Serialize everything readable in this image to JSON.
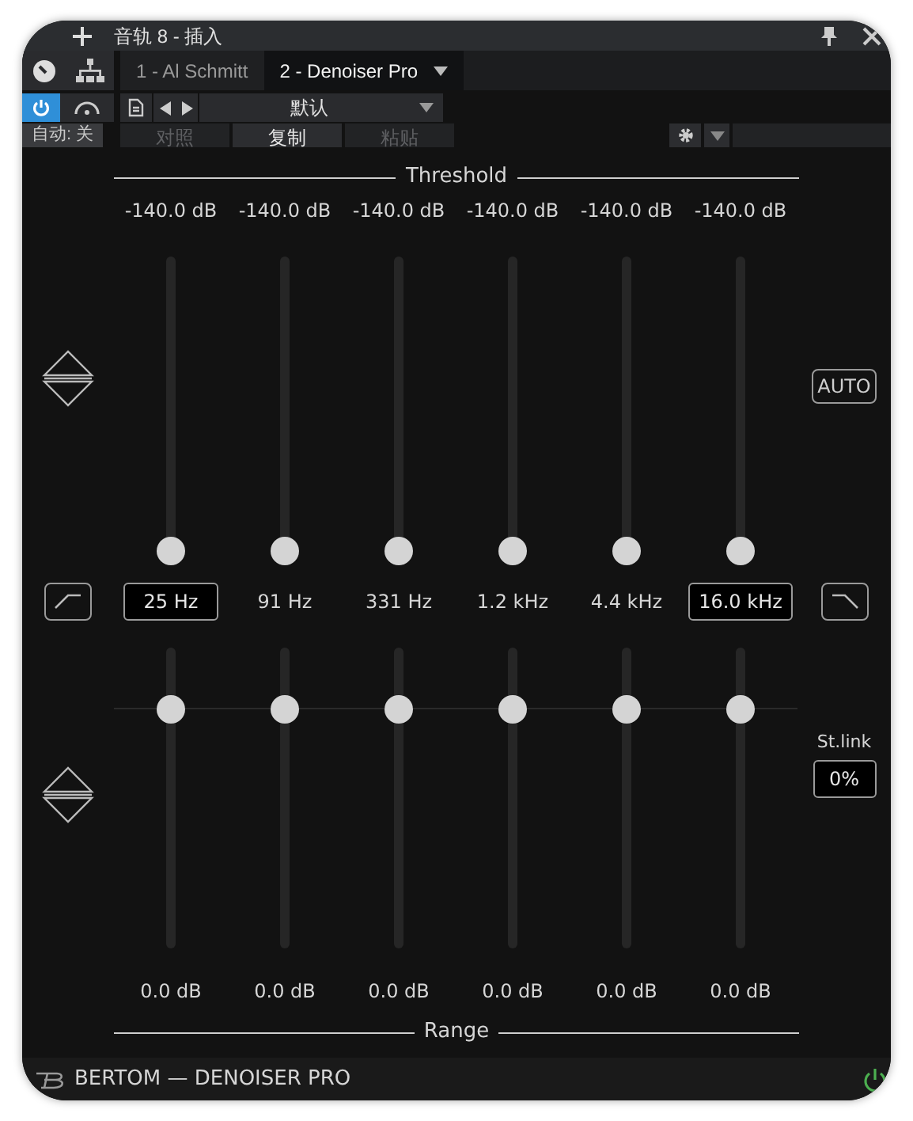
{
  "window": {
    "title": "音轨 8 - 插入"
  },
  "tabs": [
    {
      "label": "1 - Al Schmitt",
      "selected": false
    },
    {
      "label": "2 - Denoiser Pro",
      "selected": true
    }
  ],
  "toolbar": {
    "preset": "默认",
    "automation": "自动: 关",
    "power_on": true,
    "actions": [
      {
        "label": "对照",
        "disabled": true
      },
      {
        "label": "复制",
        "disabled": false
      },
      {
        "label": "粘贴",
        "disabled": true
      }
    ]
  },
  "plugin": {
    "threshold_label": "Threshold",
    "range_label": "Range",
    "auto_label": "AUTO",
    "stlink_label": "St.link",
    "stlink_value": "0%",
    "bands": [
      {
        "threshold": "-140.0 dB",
        "threshold_slider": {
          "level": 0
        },
        "frequency": "25 Hz",
        "kind": "field",
        "range": "0.0 dB",
        "range_slider": {
          "level": 0.81
        }
      },
      {
        "threshold": "-140.0 dB",
        "threshold_slider": {
          "level": 0
        },
        "frequency": "91 Hz",
        "kind": "label",
        "range": "0.0 dB",
        "range_slider": {
          "level": 0.81
        }
      },
      {
        "threshold": "-140.0 dB",
        "threshold_slider": {
          "level": 0
        },
        "frequency": "331 Hz",
        "kind": "label",
        "range": "0.0 dB",
        "range_slider": {
          "level": 0.81
        }
      },
      {
        "threshold": "-140.0 dB",
        "threshold_slider": {
          "level": 0
        },
        "frequency": "1.2 kHz",
        "kind": "label",
        "range": "0.0 dB",
        "range_slider": {
          "level": 0.81
        }
      },
      {
        "threshold": "-140.0 dB",
        "threshold_slider": {
          "level": 0
        },
        "frequency": "4.4 kHz",
        "kind": "label",
        "range": "0.0 dB",
        "range_slider": {
          "level": 0.81
        }
      },
      {
        "threshold": "-140.0 dB",
        "threshold_slider": {
          "level": 0
        },
        "frequency": "16.0 kHz",
        "kind": "field",
        "range": "0.0 dB",
        "range_slider": {
          "level": 0.81
        }
      }
    ]
  },
  "footer": {
    "brand": "BERTOM — DENOISER PRO"
  }
}
